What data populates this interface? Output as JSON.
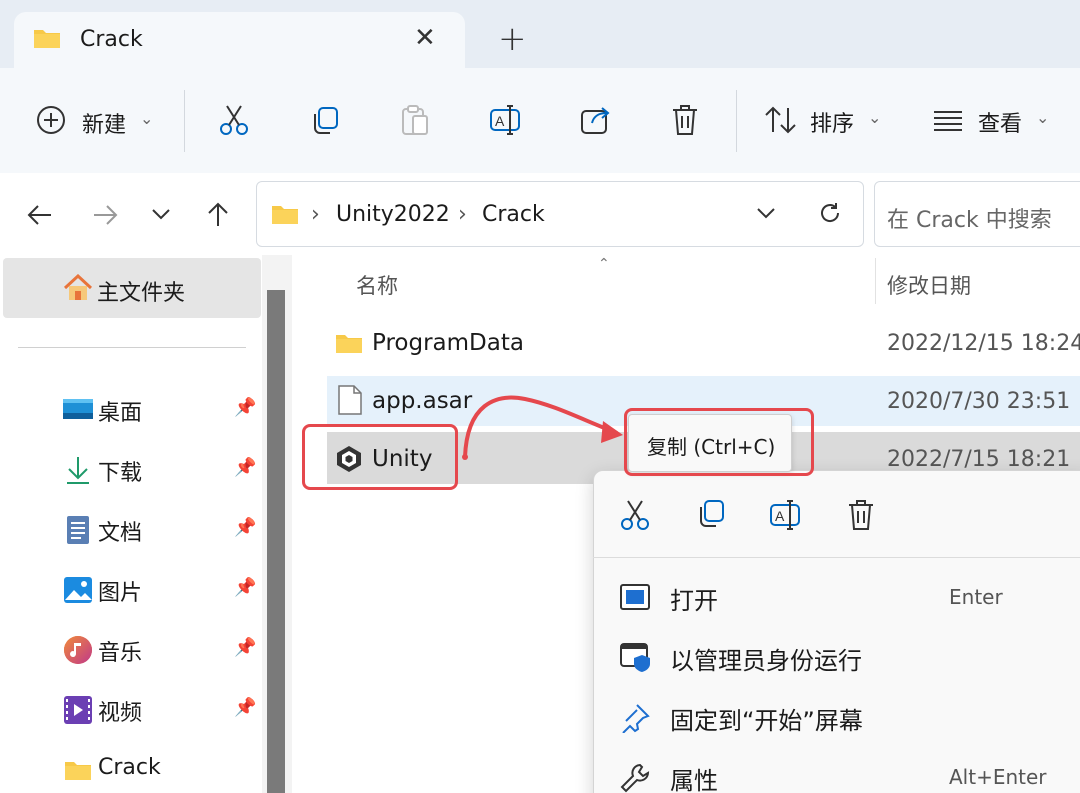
{
  "tab": {
    "title": "Crack",
    "close_glyph": "✕",
    "new_tab_glyph": "+"
  },
  "toolbar": {
    "new_label": "新建",
    "sort_label": "排序",
    "view_label": "查看"
  },
  "address": {
    "crumbs": [
      "Unity2022",
      "Crack"
    ],
    "separator": "›",
    "search_placeholder": "在 Crack 中搜索"
  },
  "sidebar": {
    "home": "主文件夹",
    "items": [
      {
        "label": "桌面",
        "icon": "desktop-icon"
      },
      {
        "label": "下载",
        "icon": "download-icon"
      },
      {
        "label": "文档",
        "icon": "document-icon"
      },
      {
        "label": "图片",
        "icon": "pictures-icon"
      },
      {
        "label": "音乐",
        "icon": "music-icon"
      },
      {
        "label": "视频",
        "icon": "video-icon"
      },
      {
        "label": "Crack",
        "icon": "folder-icon"
      }
    ]
  },
  "columns": {
    "name": "名称",
    "modified": "修改日期"
  },
  "files": [
    {
      "name": "ProgramData",
      "date": "2022/12/15 18:24",
      "icon": "folder-icon"
    },
    {
      "name": "app.asar",
      "date": "2020/7/30 23:51",
      "icon": "file-icon"
    },
    {
      "name": "Unity",
      "date": "2022/7/15 18:21",
      "icon": "unity-icon"
    }
  ],
  "tooltip": {
    "text": "复制 (Ctrl+C)"
  },
  "context_menu": {
    "items": [
      {
        "label": "打开",
        "key": "Enter"
      },
      {
        "label": "以管理员身份运行",
        "key": ""
      },
      {
        "label": "固定到“开始”屏幕",
        "key": ""
      },
      {
        "label": "属性",
        "key": "Alt+Enter"
      }
    ]
  },
  "colors": {
    "accent": "#0067c0",
    "annotation_red": "#e5484d",
    "folder_yellow": "#f7c948"
  }
}
